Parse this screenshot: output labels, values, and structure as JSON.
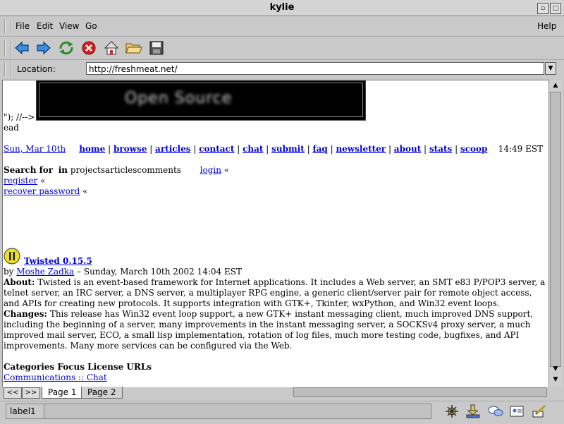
{
  "window": {
    "title": "kylie"
  },
  "menu": {
    "file": "File",
    "edit": "Edit",
    "view": "View",
    "go": "Go",
    "help": "Help"
  },
  "toolbar": {
    "icons": [
      "back-arrow-icon",
      "forward-arrow-icon",
      "reload-icon",
      "stop-icon",
      "home-icon",
      "open-folder-icon",
      "save-disk-icon"
    ]
  },
  "location": {
    "label": "Location:",
    "url": "http://freshmeat.net/"
  },
  "page": {
    "script_junk": "\"); //-->",
    "ead": "ead",
    "date": "Sun, Mar 10th",
    "nav": [
      "home",
      "browse",
      "articles",
      "contact",
      "chat",
      "submit",
      "faq",
      "newsletter",
      "about",
      "stats",
      "scoop"
    ],
    "time": "14:49 EST",
    "search_label": "Search for",
    "in_label": "in",
    "search_options": "projectsarticlescomments",
    "login": "login",
    "register": "register",
    "recover": "recover password",
    "laquo": "«",
    "article": {
      "title": "Twisted 0.15.5",
      "by": "by",
      "author": "Moshe Zadka",
      "dateline": "– Sunday, March 10th 2002 14:04 EST",
      "about_label": "About:",
      "about_text": "Twisted is an event-based framework for Internet applications. It includes a Web server, an SMT e83 P/POP3 server, a telnet server, an IRC server, a DNS server, a multiplayer RPG engine, a generic client/server pair for remote object access, and APIs for creating new protocols. It supports integration with GTK+, Tkinter, wxPython, and Win32 event loops.",
      "changes_label": "Changes:",
      "changes_text": "This release has Win32 event loop support, a new GTK+ instant messaging client, much improved DNS support, including the beginning of a server, many improvements in the instant messaging server, a SOCKSv4 proxy server, a much improved mail server, ECO, a small lisp implementation, rotation of log files, much more testing code, bugfixes, and API improvements. Many more services can be configured via the Web.",
      "categories_header": "Categories Focus License URLs",
      "category_link": "Communications :: Chat"
    }
  },
  "tabs": {
    "prev": "<<",
    "next": ">>",
    "page1": "Page 1",
    "page2": "Page 2"
  },
  "status": {
    "label": "label1"
  },
  "colors": {
    "link": "#0000ee",
    "chrome": "#c9c9c9"
  }
}
